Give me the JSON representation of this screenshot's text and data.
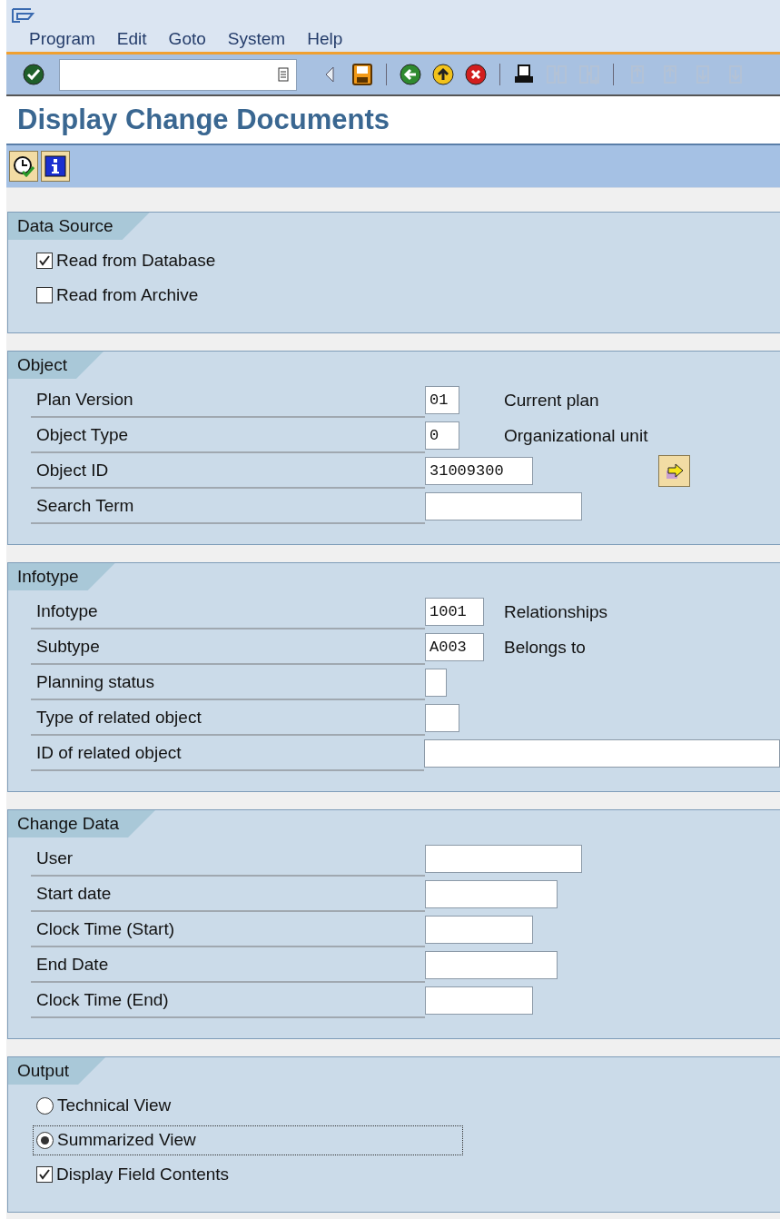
{
  "menu": [
    {
      "label": "Program"
    },
    {
      "label": "Edit"
    },
    {
      "label": "Goto"
    },
    {
      "label": "System"
    },
    {
      "label": "Help"
    }
  ],
  "toolbar": [
    {
      "kind": "enter",
      "disabled": false
    },
    {
      "kind": "command_field"
    },
    {
      "kind": "back_triangle",
      "disabled": false
    },
    {
      "kind": "save",
      "disabled": false
    },
    {
      "kind": "separator"
    },
    {
      "kind": "back",
      "disabled": false
    },
    {
      "kind": "exit",
      "disabled": false
    },
    {
      "kind": "cancel",
      "disabled": false
    },
    {
      "kind": "separator"
    },
    {
      "kind": "print",
      "disabled": false
    },
    {
      "kind": "find",
      "disabled": true
    },
    {
      "kind": "find_next",
      "disabled": true
    },
    {
      "kind": "separator"
    },
    {
      "kind": "first_page",
      "disabled": true
    },
    {
      "kind": "previous_page",
      "disabled": true
    },
    {
      "kind": "next_page",
      "disabled": true
    },
    {
      "kind": "last_page",
      "disabled": true
    }
  ],
  "title": "Display Change Documents",
  "app_toolbar": [
    {
      "kind": "execute"
    },
    {
      "kind": "info"
    }
  ],
  "sections": [
    {
      "title": "Data Source",
      "rows": [
        {
          "kind": "checkbox",
          "label": "Read from Database",
          "checked": true
        },
        {
          "kind": "checkbox",
          "label": "Read from Archive",
          "checked": false
        }
      ]
    },
    {
      "title": "Object",
      "rows": [
        {
          "kind": "field",
          "label": "Plan Version",
          "value": "01",
          "description": "Current plan"
        },
        {
          "kind": "field",
          "label": "Object Type",
          "value": "0",
          "description": "Organizational unit"
        },
        {
          "kind": "field",
          "label": "Object ID",
          "value": "31009300",
          "value_help": true
        },
        {
          "kind": "field",
          "label": "Search Term"
        }
      ]
    },
    {
      "title": "Infotype",
      "rows": [
        {
          "kind": "field",
          "label": "Infotype",
          "value": "1001",
          "description": "Relationships"
        },
        {
          "kind": "field",
          "label": "Subtype",
          "value": "A003",
          "description": "Belongs to"
        },
        {
          "kind": "field",
          "label": "Planning status"
        },
        {
          "kind": "field",
          "label": "Type of related object"
        },
        {
          "kind": "field",
          "label": "ID of related object"
        }
      ]
    },
    {
      "title": "Change Data",
      "rows": [
        {
          "kind": "field",
          "label": "User"
        },
        {
          "kind": "field",
          "label": "Start date"
        },
        {
          "kind": "field",
          "label": "Clock Time (Start)"
        },
        {
          "kind": "field",
          "label": "End Date"
        },
        {
          "kind": "field",
          "label": "Clock Time (End)"
        }
      ]
    },
    {
      "title": "Output",
      "rows": [
        {
          "kind": "radio",
          "label": "Technical View",
          "selected": false,
          "focused": false
        },
        {
          "kind": "radio",
          "label": "Summarized View",
          "selected": true,
          "focused": true
        },
        {
          "kind": "checkbox",
          "label": "Display Field Contents",
          "checked": true
        }
      ]
    }
  ]
}
